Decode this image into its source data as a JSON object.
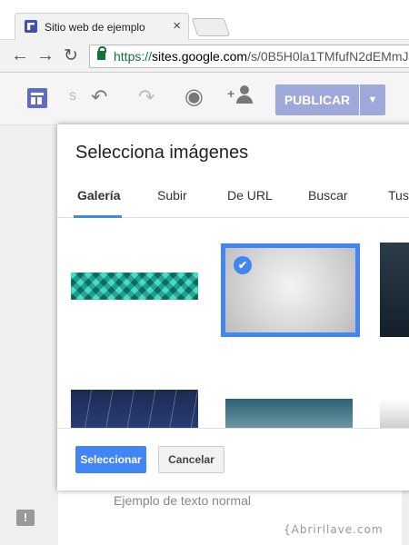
{
  "browser": {
    "tab_title": "Sitio web de ejemplo",
    "tab_close": "×",
    "url_scheme": "https://",
    "url_host": "sites.google.com",
    "url_path": "/s/0B5H0la1TMfufN2dEMmJ",
    "nav": {
      "back": "←",
      "forward": "→",
      "reload": "↻"
    }
  },
  "editor": {
    "publish_label": "PUBLICAR",
    "publish_menu": "▼",
    "undo": "↶",
    "redo": "↷",
    "preview": "◉",
    "sitename_peek": "s"
  },
  "dialog": {
    "title": "Selecciona imágenes",
    "tabs": [
      {
        "label": "Galería"
      },
      {
        "label": "Subir"
      },
      {
        "label": "De URL"
      },
      {
        "label": "Buscar"
      },
      {
        "label": "Tus"
      }
    ],
    "select_label": "Seleccionar",
    "cancel_label": "Cancelar",
    "check_mark": "✔"
  },
  "page": {
    "sample_text": "Ejemplo de texto normal",
    "feedback": "!"
  },
  "watermark": "{Abrirllave.com"
}
